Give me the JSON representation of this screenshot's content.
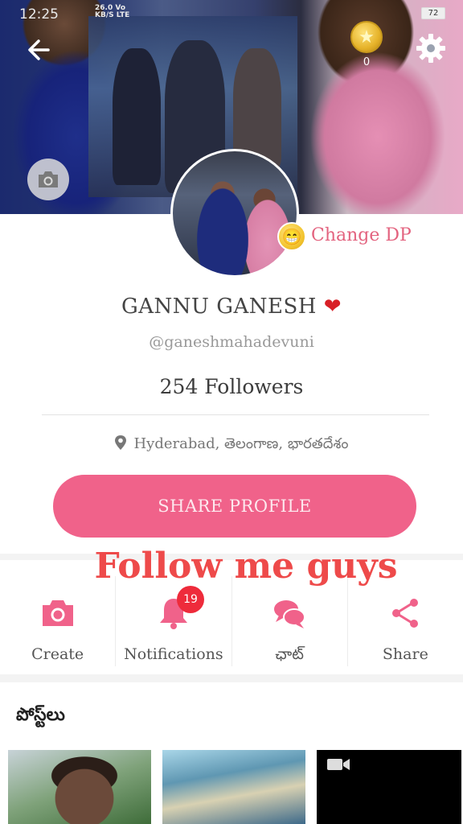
{
  "status_bar": {
    "time": "12:25",
    "network_speed": "26.0",
    "network_unit": "KB/S",
    "carrier": "Vo",
    "lte": "LTE",
    "battery": "72"
  },
  "header": {
    "coin_count": "0"
  },
  "profile": {
    "change_dp_label": "Change DP",
    "name": "GANNU GANESH",
    "name_emoji": "❤",
    "handle": "@ganeshmahadevuni",
    "followers": "254 Followers",
    "location": "Hyderabad, తెలంగాణ, భారతదేశం",
    "share_button": "SHARE PROFILE"
  },
  "overlay_caption": "Follow me guys",
  "actions": [
    {
      "label": "Create",
      "icon": "camera-icon"
    },
    {
      "label": "Notifications",
      "icon": "bell-icon",
      "badge": "19"
    },
    {
      "label": "ఛాట్",
      "icon": "chat-icon"
    },
    {
      "label": "Share",
      "icon": "share-icon"
    }
  ],
  "posts": {
    "title": "పోస్ట్‌లు"
  },
  "colors": {
    "accent": "#f0628a",
    "change_dp": "#e3637f",
    "badge": "#ee2b3b",
    "caption": "#ee4a4a"
  }
}
